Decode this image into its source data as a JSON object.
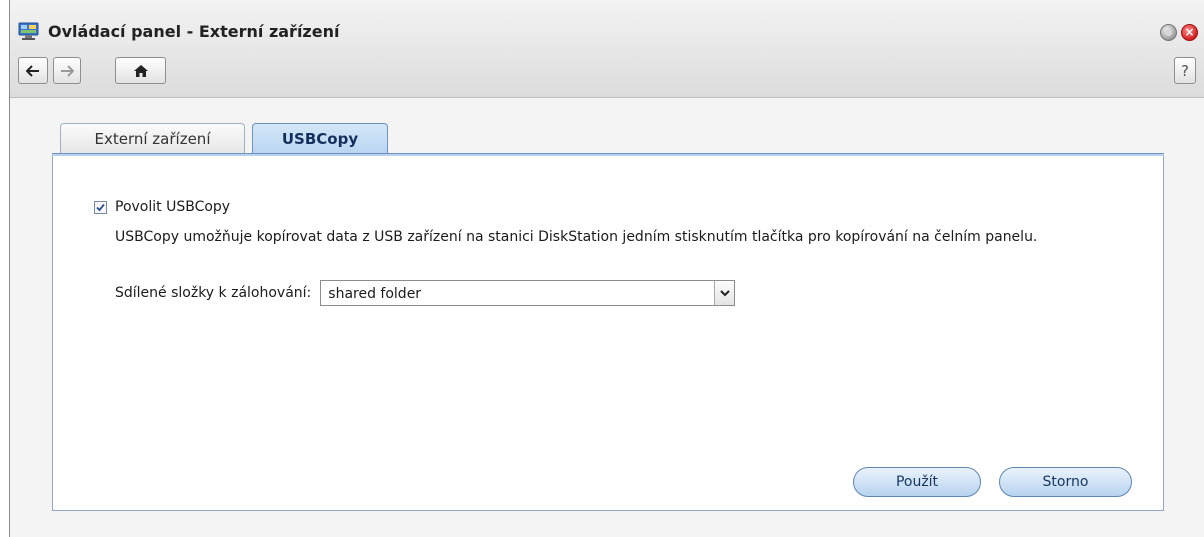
{
  "window": {
    "title": "Ovládací panel - Externí zařízení",
    "icon": "control-panel-icon",
    "close_glyph": "×"
  },
  "toolbar": {
    "back_icon": "arrow-left-icon",
    "forward_icon": "arrow-right-icon",
    "home_icon": "home-icon",
    "help_label": "?"
  },
  "tabs": [
    {
      "label": "Externí zařízení",
      "active": false
    },
    {
      "label": "USBCopy",
      "active": true
    }
  ],
  "usbcopy": {
    "enable_label": "Povolit USBCopy",
    "enable_checked": true,
    "description": "USBCopy umožňuje kopírovat data z USB zařízení na stanici DiskStation jedním stisknutím tlačítka pro kopírování na čelním panelu.",
    "folder_label": "Sdílené složky k zálohování:",
    "folder_value": "shared folder"
  },
  "buttons": {
    "apply": "Použít",
    "cancel": "Storno"
  },
  "colors": {
    "accent": "#b9d5f1",
    "tab_active_text": "#13305c",
    "close_button": "#d22020"
  }
}
